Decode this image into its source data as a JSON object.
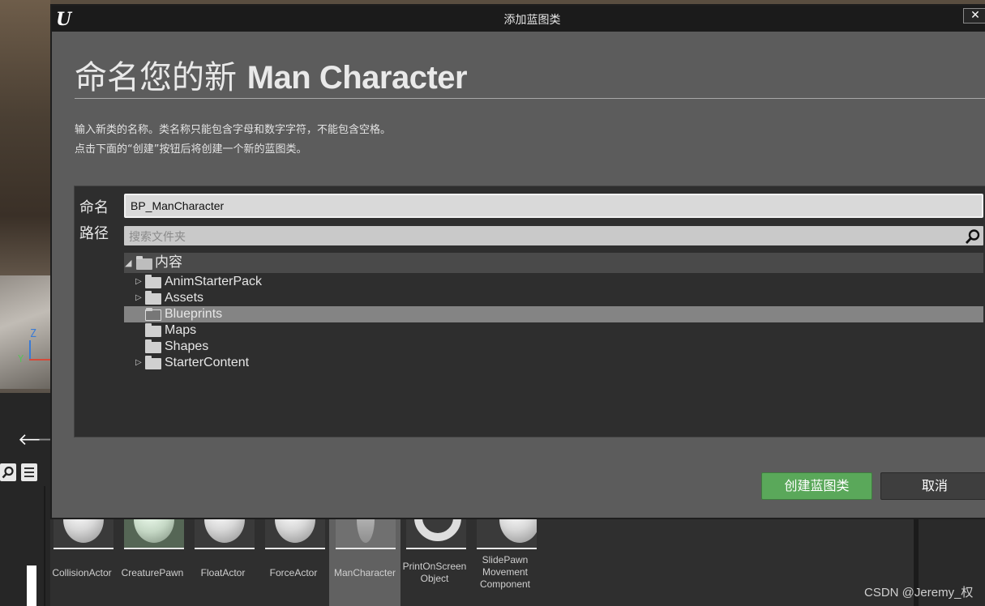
{
  "dialog": {
    "window_title": "添加蓝图类",
    "close_label": "✕",
    "heading_prefix": "命名您的新",
    "heading_class": "Man Character",
    "desc_line1": "输入新类的名称。类名称只能包含字母和数字字符，不能包含空格。",
    "desc_line2": "点击下面的“创建”按钮后将创建一个新的蓝图类。",
    "name_label": "命名",
    "name_value": "BP_ManCharacter",
    "path_label": "路径",
    "search_placeholder": "搜索文件夹",
    "tree": {
      "root": "内容",
      "items": [
        {
          "label": "AnimStarterPack",
          "expandable": true,
          "selected": false
        },
        {
          "label": "Assets",
          "expandable": true,
          "selected": false
        },
        {
          "label": "Blueprints",
          "expandable": false,
          "selected": true
        },
        {
          "label": "Maps",
          "expandable": false,
          "selected": false
        },
        {
          "label": "Shapes",
          "expandable": false,
          "selected": false
        },
        {
          "label": "StarterContent",
          "expandable": true,
          "selected": false
        }
      ]
    },
    "create_button": "创建蓝图类",
    "cancel_button": "取消"
  },
  "viewport": {
    "axis_z": "Z",
    "axis_y": "Y"
  },
  "content_browser": {
    "nav_back": "🡐",
    "nav_forward": "🡒",
    "assets": [
      {
        "label": "CollisionActor",
        "selected": false
      },
      {
        "label": "CreaturePawn",
        "selected": false
      },
      {
        "label": "FloatActor",
        "selected": false
      },
      {
        "label": "ForceActor",
        "selected": false
      },
      {
        "label": "ManCharacter",
        "selected": true
      },
      {
        "label": "PrintOnScreen Object",
        "selected": false
      },
      {
        "label": "SlidePawn Movement Component",
        "selected": false
      }
    ]
  },
  "watermark": "CSDN @Jeremy_权",
  "colors": {
    "create_button": "#5aa85a",
    "dialog_bg": "#5c5c5c",
    "panel_bg": "#2e2e2e",
    "selected_row": "#848484"
  }
}
